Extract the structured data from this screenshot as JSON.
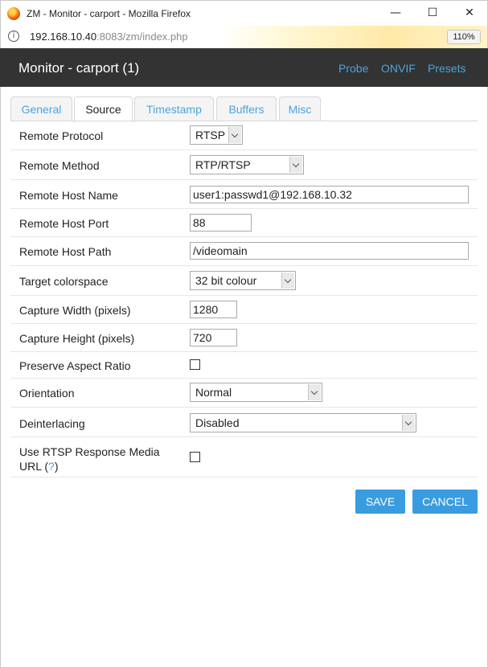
{
  "window": {
    "title": "ZM - Monitor - carport - Mozilla Firefox",
    "minimize_glyph": "—",
    "maximize_glyph": "☐",
    "close_glyph": "✕"
  },
  "urlbar": {
    "info_glyph": "i",
    "url_host": "192.168.10.40",
    "url_rest": ":8083/zm/index.php",
    "zoom": "110%"
  },
  "header": {
    "title": "Monitor - carport (1)",
    "links": {
      "probe": "Probe",
      "onvif": "ONVIF",
      "presets": "Presets"
    }
  },
  "tabs": {
    "general": "General",
    "source": "Source",
    "timestamp": "Timestamp",
    "buffers": "Buffers",
    "misc": "Misc"
  },
  "form": {
    "remote_protocol": {
      "label": "Remote Protocol",
      "value": "RTSP"
    },
    "remote_method": {
      "label": "Remote Method",
      "value": "RTP/RTSP"
    },
    "remote_host_name": {
      "label": "Remote Host Name",
      "value": "user1:passwd1@192.168.10.32"
    },
    "remote_host_port": {
      "label": "Remote Host Port",
      "value": "88"
    },
    "remote_host_path": {
      "label": "Remote Host Path",
      "value": "/videomain"
    },
    "target_colorspace": {
      "label": "Target colorspace",
      "value": "32 bit colour"
    },
    "capture_width": {
      "label": "Capture Width (pixels)",
      "value": "1280"
    },
    "capture_height": {
      "label": "Capture Height (pixels)",
      "value": "720"
    },
    "preserve_aspect": {
      "label": "Preserve Aspect Ratio",
      "checked": false
    },
    "orientation": {
      "label": "Orientation",
      "value": "Normal"
    },
    "deinterlacing": {
      "label": "Deinterlacing",
      "value": "Disabled"
    },
    "rtsp_media_url": {
      "label_line1": "Use RTSP Response Media",
      "label_line2": "URL (",
      "help": "?",
      "label_close": ")",
      "checked": false
    }
  },
  "buttons": {
    "save": "SAVE",
    "cancel": "CANCEL"
  },
  "colors": {
    "header_bg": "#333333",
    "link": "#4aa3df",
    "button": "#3a9ce0"
  }
}
